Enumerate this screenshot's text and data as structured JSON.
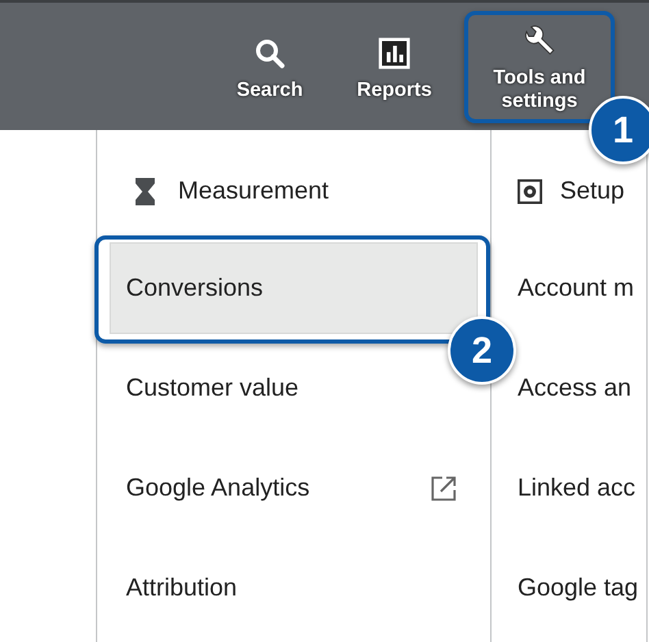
{
  "nav": [
    {
      "label": "Search"
    },
    {
      "label": "Reports"
    },
    {
      "label": "Tools and settings",
      "callout": "1"
    }
  ],
  "columns": [
    {
      "title": "Measurement",
      "items": [
        {
          "label": "Conversions",
          "selected": true,
          "external": false,
          "callout": "2"
        },
        {
          "label": "Customer value",
          "selected": false,
          "external": false
        },
        {
          "label": "Google Analytics",
          "selected": false,
          "external": true
        },
        {
          "label": "Attribution",
          "selected": false,
          "external": false
        }
      ]
    },
    {
      "title": "Setup",
      "items": [
        {
          "label": "Account m",
          "selected": false,
          "external": false
        },
        {
          "label": "Access an",
          "selected": false,
          "external": false
        },
        {
          "label": "Linked acc",
          "selected": false,
          "external": false
        },
        {
          "label": "Google tag",
          "selected": false,
          "external": false
        }
      ]
    }
  ]
}
